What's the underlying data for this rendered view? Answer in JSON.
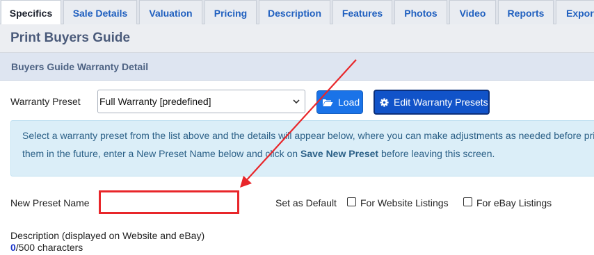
{
  "tabs": [
    "Specifics",
    "Sale Details",
    "Valuation",
    "Pricing",
    "Description",
    "Features",
    "Photos",
    "Video",
    "Reports",
    "Export"
  ],
  "active_tab": "Specifics",
  "page_title": "Print Buyers Guide",
  "section_title": "Buyers Guide Warranty Detail",
  "warranty_preset": {
    "label": "Warranty Preset",
    "selected": "Full Warranty [predefined]",
    "load_label": "Load",
    "edit_label": "Edit Warranty Presets"
  },
  "info": {
    "line1": "Select a warranty preset from the list above and the details will appear below, where you can make adjustments as needed before printing. To save them in the future, enter a New Preset Name below and click on",
    "line1_visible": "Select a warranty preset from the list above and the details will appear below, where you can make adjustments as needed before print",
    "line2_prefix": "them in the future, enter a New Preset Name below and click on ",
    "line2_bold": "Save New Preset",
    "line2_suffix": " before leaving this screen."
  },
  "new_preset": {
    "label": "New Preset Name",
    "value": ""
  },
  "default": {
    "label": "Set as Default",
    "website_label": "For Website Listings",
    "website_checked": false,
    "ebay_label": "For eBay Listings",
    "ebay_checked": false
  },
  "description": {
    "label": "Description (displayed on Website and eBay)",
    "count": "0",
    "max_text": "/500 characters"
  },
  "colors": {
    "annotation_red": "#e8262a",
    "primary_blue": "#1a73e8",
    "dark_blue": "#1153c9",
    "info_bg": "#dbeef8"
  }
}
